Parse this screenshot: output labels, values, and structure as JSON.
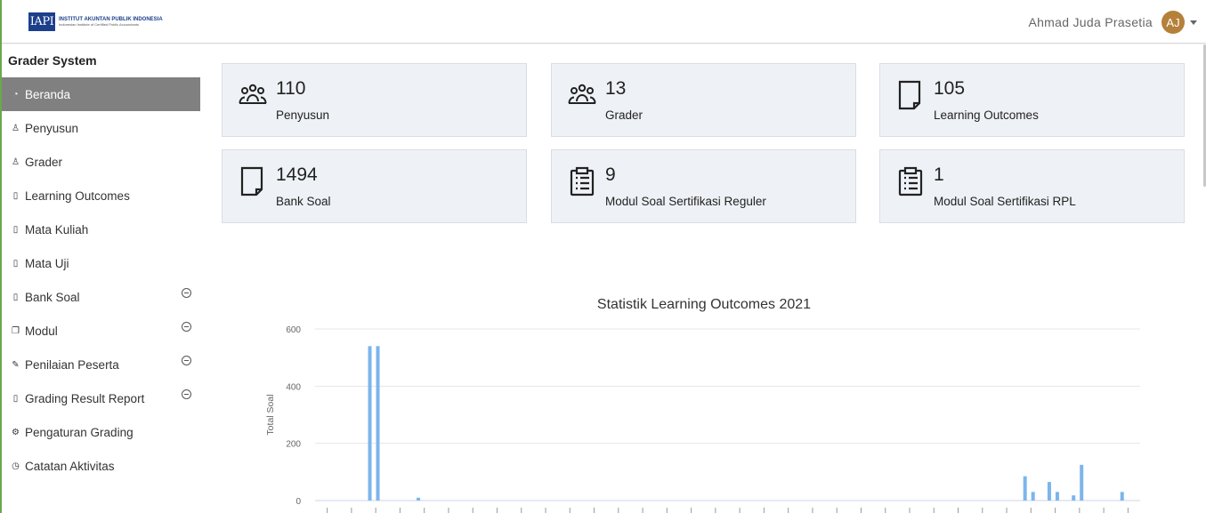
{
  "header": {
    "logo_mark": "IAPI",
    "logo_line1": "INSTITUT AKUNTAN PUBLIK INDONESIA",
    "logo_line2": "Indonesian Institute of Certified Public Accountants",
    "user_name": "Ahmad Juda Prasetia",
    "avatar_initials": "AJ"
  },
  "sidebar": {
    "title": "Grader System",
    "items": [
      {
        "label": "Beranda",
        "icon": "dashboard-icon",
        "active": true,
        "expandable": false
      },
      {
        "label": "Penyusun",
        "icon": "user-icon",
        "active": false,
        "expandable": false
      },
      {
        "label": "Grader",
        "icon": "user-icon",
        "active": false,
        "expandable": false
      },
      {
        "label": "Learning Outcomes",
        "icon": "document-icon",
        "active": false,
        "expandable": false
      },
      {
        "label": "Mata Kuliah",
        "icon": "document-icon",
        "active": false,
        "expandable": false
      },
      {
        "label": "Mata Uji",
        "icon": "document-icon",
        "active": false,
        "expandable": false
      },
      {
        "label": "Bank Soal",
        "icon": "document-icon",
        "active": false,
        "expandable": true
      },
      {
        "label": "Modul",
        "icon": "copy-icon",
        "active": false,
        "expandable": true
      },
      {
        "label": "Penilaian Peserta",
        "icon": "edit-icon",
        "active": false,
        "expandable": true
      },
      {
        "label": "Grading Result Report",
        "icon": "document-icon",
        "active": false,
        "expandable": true
      },
      {
        "label": "Pengaturan Grading",
        "icon": "gear-icon",
        "active": false,
        "expandable": false
      },
      {
        "label": "Catatan Aktivitas",
        "icon": "clock-icon",
        "active": false,
        "expandable": false
      }
    ]
  },
  "stats": [
    {
      "value": "110",
      "label": "Penyusun",
      "icon": "users-icon"
    },
    {
      "value": "13",
      "label": "Grader",
      "icon": "users-icon"
    },
    {
      "value": "105",
      "label": "Learning Outcomes",
      "icon": "document-icon"
    },
    {
      "value": "1494",
      "label": "Bank Soal",
      "icon": "document-icon"
    },
    {
      "value": "9",
      "label": "Modul Soal Sertifikasi Reguler",
      "icon": "clipboard-icon"
    },
    {
      "value": "1",
      "label": "Modul Soal Sertifikasi RPL",
      "icon": "clipboard-icon"
    }
  ],
  "colors": {
    "accent_border": "#6aa84f",
    "active_menu": "#808080",
    "card_bg": "#eef1f5",
    "bar": "#7cb5ec",
    "avatar": "#b5803a"
  },
  "chart_data": {
    "type": "bar",
    "title": "Statistik Learning Outcomes 2021",
    "xlabel": "",
    "ylabel": "Total Soal",
    "ylim": [
      0,
      600
    ],
    "yticks": [
      0,
      200,
      400,
      600
    ],
    "grid": true,
    "category_count": 34,
    "series": [
      {
        "values": [
          [
            0,
            0
          ],
          [
            0,
            0
          ],
          [
            540,
            540
          ],
          [
            0,
            0
          ],
          [
            10,
            0
          ],
          [
            0,
            0
          ],
          [
            0,
            0
          ],
          [
            0,
            0
          ],
          [
            0,
            0
          ],
          [
            0,
            0
          ],
          [
            0,
            0
          ],
          [
            0,
            0
          ],
          [
            0,
            0
          ],
          [
            0,
            0
          ],
          [
            0,
            0
          ],
          [
            0,
            0
          ],
          [
            0,
            0
          ],
          [
            0,
            0
          ],
          [
            0,
            0
          ],
          [
            0,
            0
          ],
          [
            0,
            0
          ],
          [
            0,
            0
          ],
          [
            0,
            0
          ],
          [
            0,
            0
          ],
          [
            0,
            0
          ],
          [
            0,
            0
          ],
          [
            0,
            0
          ],
          [
            0,
            0
          ],
          [
            0,
            0
          ],
          [
            85,
            30
          ],
          [
            65,
            30
          ],
          [
            18,
            125
          ],
          [
            0,
            0
          ],
          [
            30,
            0
          ]
        ]
      }
    ]
  }
}
